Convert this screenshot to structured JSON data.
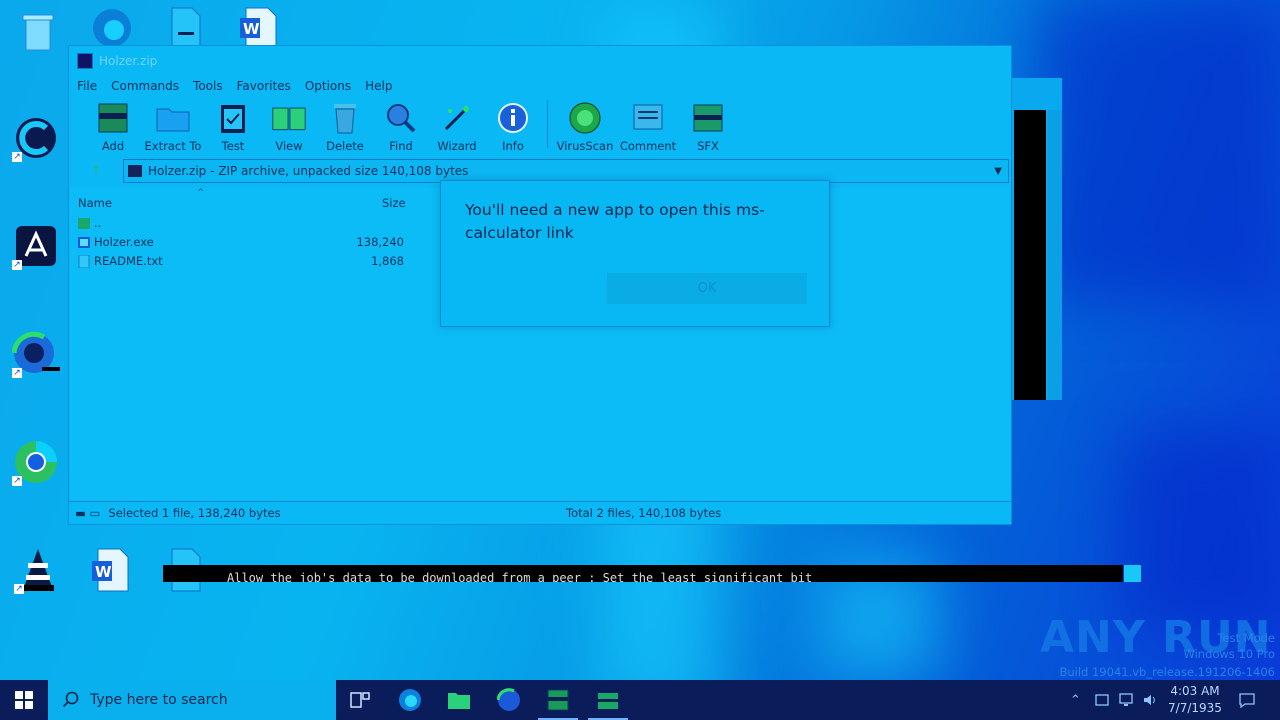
{
  "window": {
    "title": "Holzer.zip",
    "menu": [
      "File",
      "Commands",
      "Tools",
      "Favorites",
      "Options",
      "Help"
    ],
    "toolbar": [
      "Add",
      "Extract To",
      "Test",
      "View",
      "Delete",
      "Find",
      "Wizard",
      "Info",
      "VirusScan",
      "Comment",
      "SFX"
    ],
    "address": "Holzer.zip - ZIP archive, unpacked size 140,108 bytes",
    "columns": {
      "name": "Name",
      "size": "Size"
    },
    "files": [
      {
        "name": "..",
        "size": ""
      },
      {
        "name": "Holzer.exe",
        "size": "138,240"
      },
      {
        "name": "README.txt",
        "size": "1,868"
      }
    ],
    "status_left": "Selected 1 file, 138,240 bytes",
    "status_right": "Total 2 files, 140,108 bytes"
  },
  "dialog": {
    "message": "You'll need a new app to open this ms-calculator link",
    "ok_label": "OK"
  },
  "console": {
    "text": "Allow the job's data to be downloaded from a peer : Set the least significant bit"
  },
  "watermark": {
    "brand": "ANY RUN",
    "line1": "Test Mode",
    "line2": "Windows 10 Pro",
    "line3": "Build 19041.vb_release.191206-1406"
  },
  "taskbar": {
    "search_placeholder": "Type here to search",
    "time": "4:03 AM",
    "date": "7/7/1935"
  }
}
